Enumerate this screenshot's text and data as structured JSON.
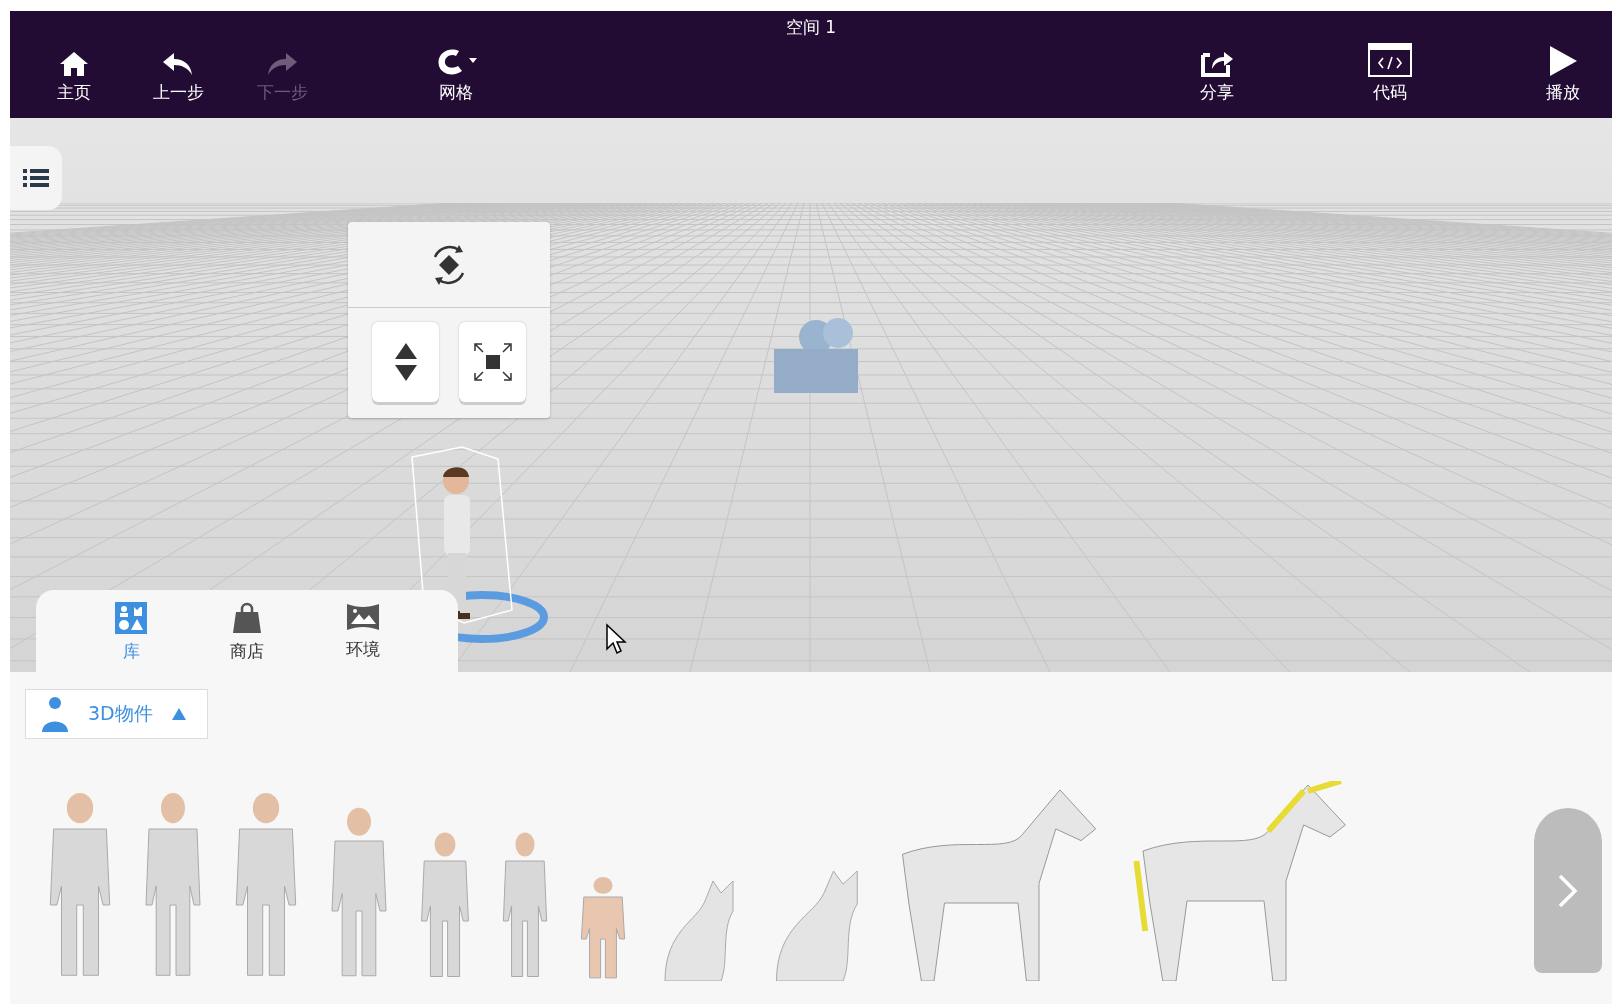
{
  "window": {
    "title": "空间 1"
  },
  "toolbar": {
    "left": [
      {
        "kind": "home",
        "label": "主页",
        "disabled": false
      },
      {
        "kind": "undo",
        "label": "上一步",
        "disabled": false
      },
      {
        "kind": "redo",
        "label": "下一步",
        "disabled": true
      }
    ],
    "grid": {
      "label": "网格"
    },
    "right": [
      {
        "kind": "share",
        "label": "分享",
        "disabled": false
      },
      {
        "kind": "code",
        "label": "代码",
        "disabled": false
      },
      {
        "kind": "play",
        "label": "播放",
        "disabled": false
      }
    ]
  },
  "library_tabs": [
    {
      "kind": "library",
      "label": "库",
      "selected": true
    },
    {
      "kind": "store",
      "label": "商店",
      "selected": false
    },
    {
      "kind": "environment",
      "label": "环境",
      "selected": false
    }
  ],
  "category": {
    "label": "3D物件",
    "expanded": true
  }
}
